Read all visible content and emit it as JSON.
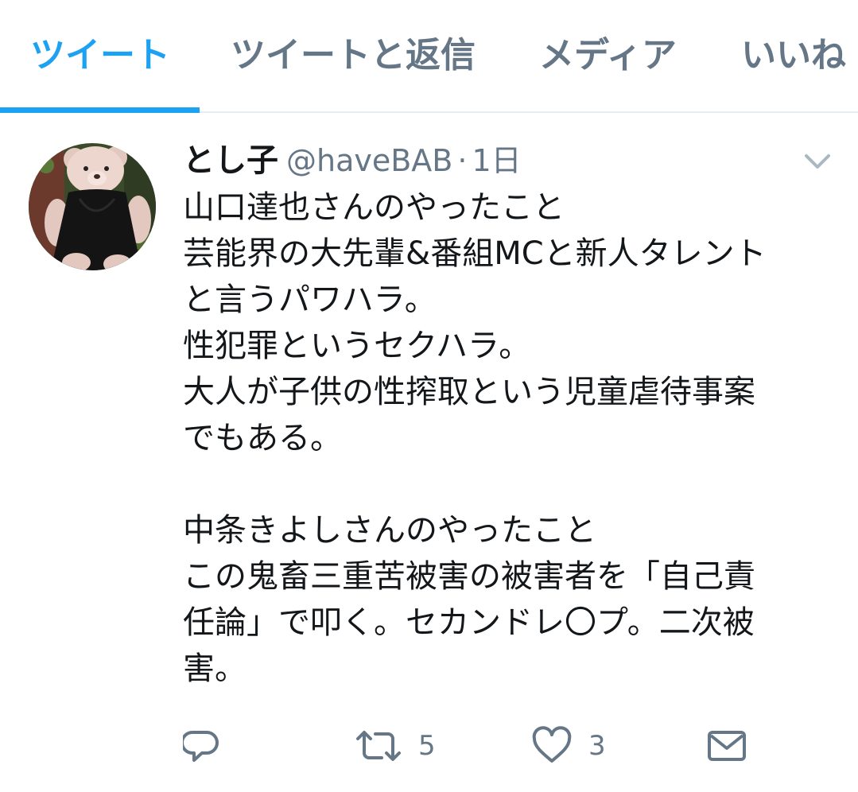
{
  "tabs": [
    {
      "label": "ツイート",
      "active": true
    },
    {
      "label": "ツイートと返信",
      "active": false
    },
    {
      "label": "メディア",
      "active": false
    },
    {
      "label": "いいね",
      "active": false
    }
  ],
  "tweet": {
    "display_name": "とし子",
    "handle": "@haveBAB",
    "separator": "·",
    "time": "1日",
    "lines": [
      "山口達也さんのやったこと",
      "芸能界の大先輩&番組MCと新人タレント",
      "と言うパワハラ。",
      "性犯罪というセクハラ。",
      "大人が子供の性搾取という児童虐待事案",
      "でもある。",
      "",
      "中条きよしさんのやったこと",
      "この鬼畜三重苦被害の被害者を「自己責",
      "任論」で叩く。セカンドレ〇プ。二次被",
      "害。"
    ],
    "actions": {
      "reply_icon": "reply-icon",
      "retweet_icon": "retweet-icon",
      "retweet_count": "5",
      "like_icon": "heart-icon",
      "like_count": "3",
      "dm_icon": "envelope-icon"
    }
  },
  "colors": {
    "accent": "#1da1f2",
    "text": "#14171a",
    "secondary": "#657786",
    "divider": "#e6ecf0"
  }
}
